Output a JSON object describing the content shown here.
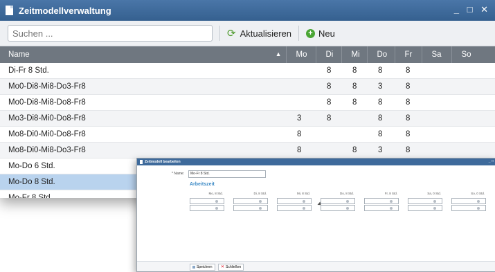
{
  "window": {
    "title": "Zeitmodellverwaltung",
    "controls": "_ □ ✕"
  },
  "toolbar": {
    "search_placeholder": "Suchen ...",
    "refresh_label": "Aktualisieren",
    "new_label": "Neu"
  },
  "columns": [
    "Name",
    "Mo",
    "Di",
    "Mi",
    "Do",
    "Fr",
    "Sa",
    "So"
  ],
  "rows": [
    {
      "name": "Di-Fr 8 Std.",
      "mo": "",
      "di": "8",
      "mi": "8",
      "do": "8",
      "fr": "8",
      "sa": "",
      "so": ""
    },
    {
      "name": "Mo0-Di8-Mi8-Do3-Fr8",
      "mo": "",
      "di": "8",
      "mi": "8",
      "do": "3",
      "fr": "8",
      "sa": "",
      "so": ""
    },
    {
      "name": "Mo0-Di8-Mi8-Do8-Fr8",
      "mo": "",
      "di": "8",
      "mi": "8",
      "do": "8",
      "fr": "8",
      "sa": "",
      "so": ""
    },
    {
      "name": "Mo3-Di8-Mi0-Do8-Fr8",
      "mo": "3",
      "di": "8",
      "mi": "",
      "do": "8",
      "fr": "8",
      "sa": "",
      "so": ""
    },
    {
      "name": "Mo8-Di0-Mi0-Do8-Fr8",
      "mo": "8",
      "di": "",
      "mi": "",
      "do": "8",
      "fr": "8",
      "sa": "",
      "so": ""
    },
    {
      "name": "Mo8-Di0-Mi8-Do3-Fr8",
      "mo": "8",
      "di": "",
      "mi": "8",
      "do": "3",
      "fr": "8",
      "sa": "",
      "so": ""
    },
    {
      "name": "Mo-Do 6 Std.",
      "mo": "",
      "di": "",
      "mi": "",
      "do": "",
      "fr": "",
      "sa": "",
      "so": ""
    },
    {
      "name": "Mo-Do 8 Std.",
      "mo": "",
      "di": "",
      "mi": "",
      "do": "",
      "fr": "",
      "sa": "",
      "so": ""
    },
    {
      "name": "Mo-Fr 8 Std.",
      "mo": "",
      "di": "",
      "mi": "",
      "do": "",
      "fr": "",
      "sa": "",
      "so": ""
    }
  ],
  "dialog": {
    "title": "Zeitmodell bearbeiten",
    "name_label": "* Name:",
    "name_value": "Mo-Fr 8 Std.",
    "section_title": "Arbeitszeit",
    "day_headers": [
      "Mo, 8 Std.",
      "Di, 8 Std.",
      "Mi, 8 Std.",
      "Do, 8 Std.",
      "Fr, 8 Std.",
      "Sa, 0 Std.",
      "So, 0 Std."
    ],
    "save_label": "Speichern",
    "close_label": "Schließen",
    "controls": "_ □"
  }
}
